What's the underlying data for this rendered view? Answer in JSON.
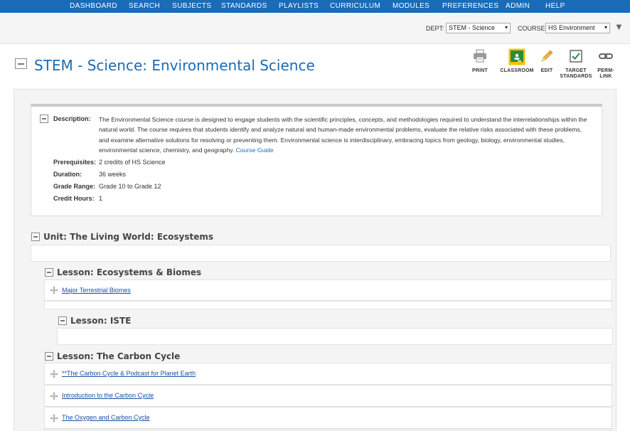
{
  "nav": {
    "items": [
      "DASHBOARD",
      "SEARCH",
      "SUBJECTS",
      "STANDARDS",
      "PLAYLISTS",
      "CURRICULUM",
      "MODULES",
      "PREFERENCES",
      "ADMIN",
      "HELP"
    ]
  },
  "selectors": {
    "dept_label": "DEPT:",
    "dept_value": "STEM - Science",
    "course_label": "COURSE:",
    "course_value": "HS Environment"
  },
  "page": {
    "title": "STEM - Science: Environmental Science"
  },
  "toolbar": {
    "print": "PRINT",
    "classroom": "CLASSROOM",
    "edit": "EDIT",
    "target_standards_1": "TARGET",
    "target_standards_2": "STANDARDS",
    "permlink_1": "PERM-",
    "permlink_2": "LINK"
  },
  "course_info": {
    "description_label": "Description:",
    "description_text": "The Environmental Science course is designed to engage students with the scientific principles, concepts, and methodologies required to understand the interrelationships within the natural world. The course requires that students identify and analyze natural and human-made environmental problems, evaluate the relative risks associated with these problems, and examine alternative solutions for resolving or preventing them. Environmental science is interdisciplinary, embracing topics from geology, biology, environmental studies, environmental science, chemistry, and geography.",
    "course_guide_link": "Course Guide",
    "prerequisites_label": "Prerequisites:",
    "prerequisites_value": "2 credits of HS Science",
    "duration_label": "Duration:",
    "duration_value": "36 weeks",
    "grade_range_label": "Grade Range:",
    "grade_range_value": "Grade 10 to Grade 12",
    "credit_hours_label": "Credit Hours:",
    "credit_hours_value": "1"
  },
  "unit": {
    "title": "Unit: The Living World: Ecosystems"
  },
  "lessons": [
    {
      "title": "Lesson: Ecosystems & Biomes",
      "resources": [
        "Major Terrestrial Biomes"
      ]
    },
    {
      "title": "Lesson: ISTE",
      "resources": []
    },
    {
      "title": "Lesson: The Carbon Cycle",
      "resources": [
        "**The Carbon Cycle & Podcast for Planet Earth",
        "Introduction to the Carbon Cycle",
        "The Oxygen and Carbon Cycle"
      ]
    }
  ],
  "colors": {
    "nav_bg": "#1a6bb8",
    "title_blue": "#1a6bb8",
    "classroom_green": "#2e8b3e",
    "classroom_highlight": "#f2c200"
  }
}
